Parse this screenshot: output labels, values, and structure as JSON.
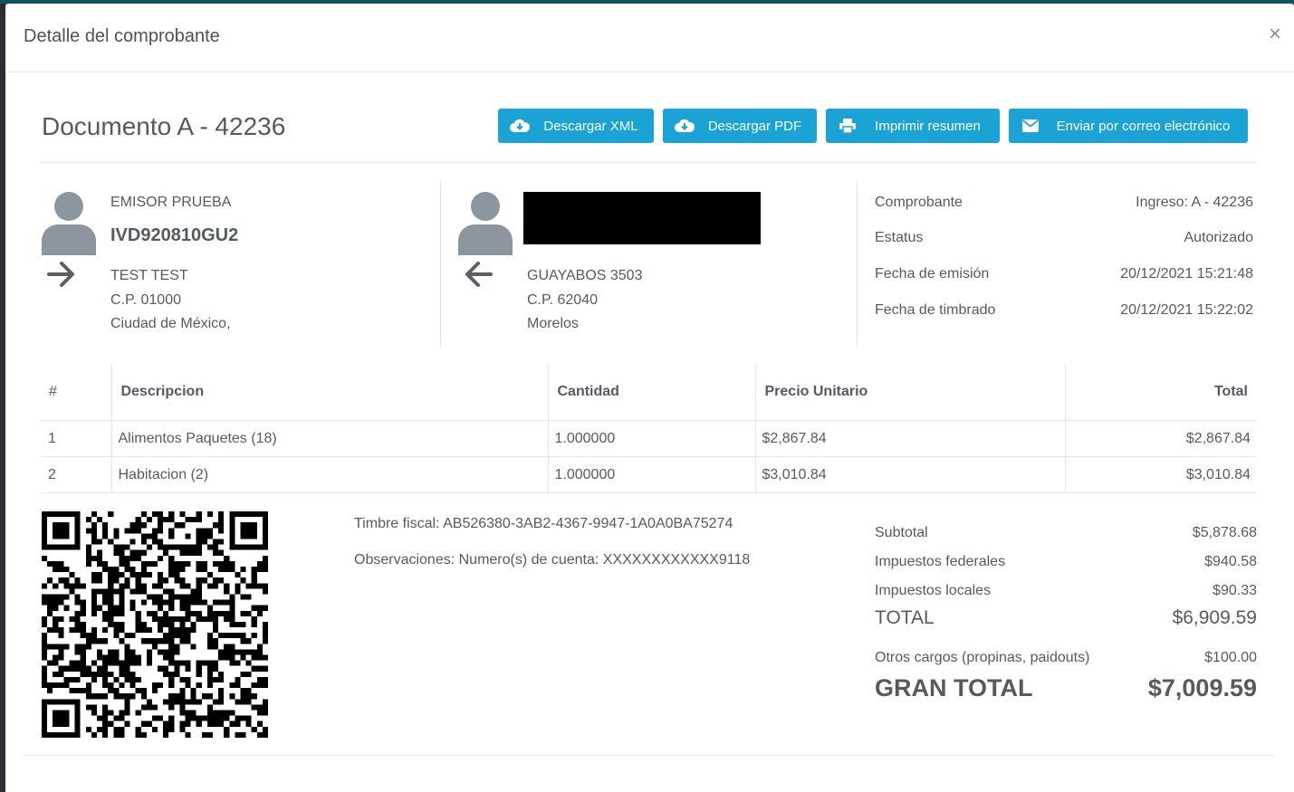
{
  "modal": {
    "title": "Detalle del comprobante",
    "close": "×"
  },
  "document": {
    "title": "Documento A - 42236"
  },
  "buttons": {
    "xml": "Descargar XML",
    "pdf": "Descargar PDF",
    "print": "Imprimir resumen",
    "email": "Enviar por correo electrónico"
  },
  "issuer": {
    "name": "EMISOR PRUEBA",
    "rfc": "IVD920810GU2",
    "address": "TEST TEST",
    "zip": "C.P. 01000",
    "city": "Ciudad de México,"
  },
  "receiver": {
    "address": "GUAYABOS 3503",
    "zip": "C.P. 62040",
    "state": "Morelos"
  },
  "info": [
    {
      "label": "Comprobante",
      "value": "Ingreso: A - 42236"
    },
    {
      "label": "Estatus",
      "value": "Autorizado"
    },
    {
      "label": "Fecha de emisión",
      "value": "20/12/2021 15:21:48"
    },
    {
      "label": "Fecha de timbrado",
      "value": "20/12/2021 15:22:02"
    }
  ],
  "table": {
    "headers": [
      "#",
      "Descripcion",
      "Cantidad",
      "Precio Unitario",
      "Total"
    ],
    "rows": [
      [
        "1",
        "Alimentos Paquetes (18)",
        "1.000000",
        "$2,867.84",
        "$2,867.84"
      ],
      [
        "2",
        "Habitacion (2)",
        "1.000000",
        "$3,010.84",
        "$3,010.84"
      ]
    ]
  },
  "fiscal": {
    "stamp": "Timbre fiscal: AB526380-3AB2-4367-9947-1A0A0BA75274",
    "notes": "Observaciones: Numero(s) de cuenta: XXXXXXXXXXXX9118"
  },
  "totals": {
    "subtotal_label": "Subtotal",
    "subtotal": "$5,878.68",
    "federal_label": "Impuestos federales",
    "federal": "$940.58",
    "local_label": "Impuestos locales",
    "local": "$90.33",
    "total_label": "TOTAL",
    "total": "$6,909.59",
    "other_label": "Otros cargos (propinas, paidouts)",
    "other": "$100.00",
    "grand_label": "GRAN TOTAL",
    "grand": "$7,009.59"
  },
  "colors": {
    "accent": "#1ba3d6",
    "text": "#555a60",
    "icon": "#8d969e"
  }
}
